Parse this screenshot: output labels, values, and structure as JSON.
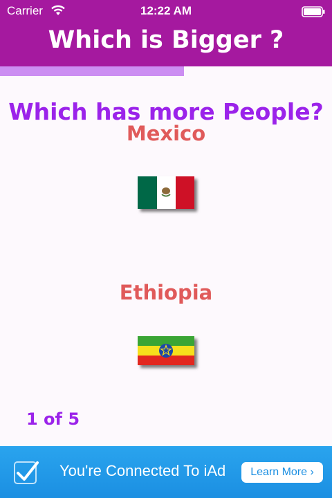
{
  "status_bar": {
    "carrier": "Carrier",
    "time": "12:22 AM",
    "wifi_icon": "wifi-icon",
    "battery_icon": "battery-icon"
  },
  "header": {
    "title": "Which is Bigger ?",
    "background_color": "#a5199f"
  },
  "progress": {
    "fraction": 0.554,
    "color": "#cc8ef2"
  },
  "quiz": {
    "question": "Which has more People?",
    "options": [
      {
        "name": "Mexico",
        "flag_icon": "mexico-flag-icon"
      },
      {
        "name": "Ethiopia",
        "flag_icon": "ethiopia-flag-icon"
      }
    ],
    "counter": "1 of 5"
  },
  "ad": {
    "text": "You're Connected To iAd",
    "button_label": "Learn More ›",
    "icon": "checkbox-check-icon",
    "color": "#1b8fe2"
  }
}
